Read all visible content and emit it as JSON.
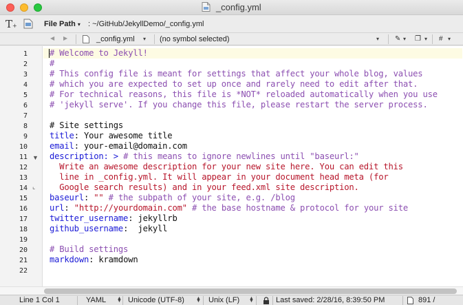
{
  "window": {
    "title": "_config.yml"
  },
  "toolbar": {
    "text_tool": "T",
    "text_tool_sub": "+",
    "file_path_label": "File Path",
    "file_path_caret": "▾",
    "file_path_value": ": ~/GitHub/JekyllDemo/_config.yml"
  },
  "navbar": {
    "back": "◀",
    "forward": "▶",
    "file_name": "_config.yml",
    "symbol": "(no symbol selected)",
    "dropdown": "▾",
    "pen_icon": "✎",
    "pages_icon": "❐",
    "hash": "#"
  },
  "editor": {
    "line_numbers": [
      "1",
      "2",
      "3",
      "4",
      "5",
      "6",
      "7",
      "8",
      "9",
      "10",
      "11",
      "12",
      "13",
      "14",
      "15",
      "16",
      "17",
      "18",
      "19",
      "20",
      "21",
      "22"
    ],
    "fold_marks": {
      "open": "▼",
      "close": "⌞"
    },
    "lines": {
      "l1": "# Welcome to Jekyll!",
      "l2": "#",
      "l3": "# This config file is meant for settings that affect your whole blog, values",
      "l4": "# which you are expected to set up once and rarely need to edit after that.",
      "l5": "# For technical reasons, this file is *NOT* reloaded automatically when you use",
      "l6": "# 'jekyll serve'. If you change this file, please restart the server process.",
      "l8": "# Site settings",
      "l9_key": "title",
      "l9_val": ": Your awesome title",
      "l10_key": "email",
      "l10_val": ": your-email@domain.com",
      "l11_key": "description",
      "l11_op": ": >",
      "l11_comment": " # this means to ignore newlines until \"baseurl:\"",
      "l12": "  Write an awesome description for your new site here. You can edit this",
      "l13": "  line in _config.yml. It will appear in your document head meta (for",
      "l14": "  Google search results) and in your feed.xml site description.",
      "l15_key": "baseurl",
      "l15_colon": ": ",
      "l15_str": "\"\"",
      "l15_comment": " # the subpath of your site, e.g. /blog",
      "l16_key": "url",
      "l16_colon": ": ",
      "l16_str": "\"http://yourdomain.com\"",
      "l16_comment": " # the base hostname & protocol for your site",
      "l17_key": "twitter_username",
      "l17_val": ": jekyllrb",
      "l18_key": "github_username",
      "l18_val": ":  jekyll",
      "l20": "# Build settings",
      "l21_key": "markdown",
      "l21_val": ": kramdown"
    }
  },
  "status": {
    "position": "Line 1 Col 1",
    "language": "YAML",
    "encoding": "Unicode (UTF-8)",
    "line_endings": "Unix (LF)",
    "saved": "Last saved: 2/28/16, 8:39:50 PM",
    "size": "891 /"
  },
  "colors": {
    "comment": "#8c4fb1",
    "key": "#1a1ad6",
    "string": "#b7162b",
    "current_line": "#fdfbe3"
  }
}
